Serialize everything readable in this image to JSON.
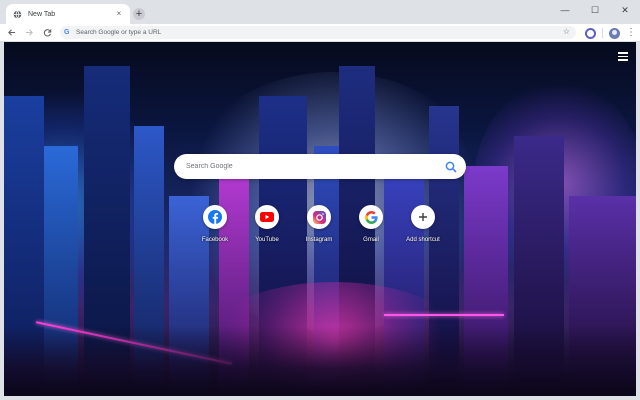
{
  "tab": {
    "title": "New Tab",
    "favicon": "globe-icon",
    "close": "×"
  },
  "newtab": {
    "label": "+"
  },
  "window": {
    "minimize": "—",
    "maximize": "☐",
    "close": "✕"
  },
  "omnibox": {
    "placeholder": "Search Google or type a URL",
    "star": "☆"
  },
  "search": {
    "placeholder": "Search Google"
  },
  "shortcuts": [
    {
      "label": "Facebook",
      "icon": "facebook-icon",
      "color": "#1877f2"
    },
    {
      "label": "YouTube",
      "icon": "youtube-icon",
      "color": "#ff0000"
    },
    {
      "label": "Instagram",
      "icon": "instagram-icon",
      "color": "#d62976"
    },
    {
      "label": "Gmail",
      "icon": "google-icon",
      "color": "#4285f4"
    },
    {
      "label": "Add shortcut",
      "icon": "plus-icon",
      "color": "#3c4043"
    }
  ],
  "colors": {
    "accent": "#4285f4",
    "chrome": "#dee1e6",
    "neon_pink": "#ff3bd5"
  }
}
